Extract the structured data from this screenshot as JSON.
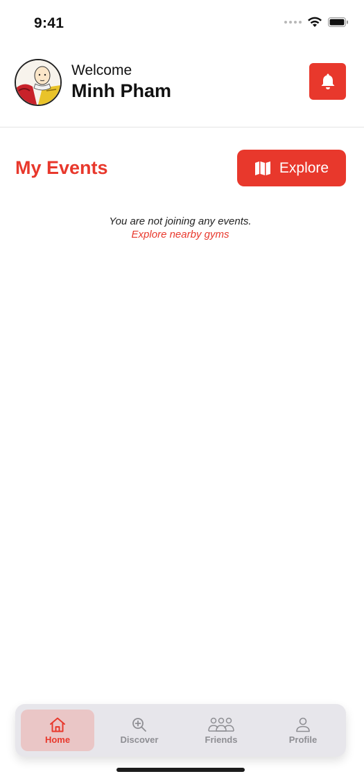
{
  "status_bar": {
    "time": "9:41"
  },
  "header": {
    "welcome": "Welcome",
    "user_name": "Minh Pham",
    "bell_icon": "bell-icon"
  },
  "events": {
    "title": "My Events",
    "explore_label": "Explore",
    "explore_icon": "map-icon",
    "empty_message": "You are not joining any events.",
    "empty_link": "Explore nearby gyms"
  },
  "tabbar": {
    "items": [
      {
        "label": "Home",
        "icon": "home-icon",
        "active": true
      },
      {
        "label": "Discover",
        "icon": "discover-icon",
        "active": false
      },
      {
        "label": "Friends",
        "icon": "friends-icon",
        "active": false
      },
      {
        "label": "Profile",
        "icon": "profile-icon",
        "active": false
      }
    ]
  },
  "colors": {
    "accent": "#e8382c",
    "active_tab_bg": "#eac6c6",
    "inactive": "#8e8e93"
  }
}
